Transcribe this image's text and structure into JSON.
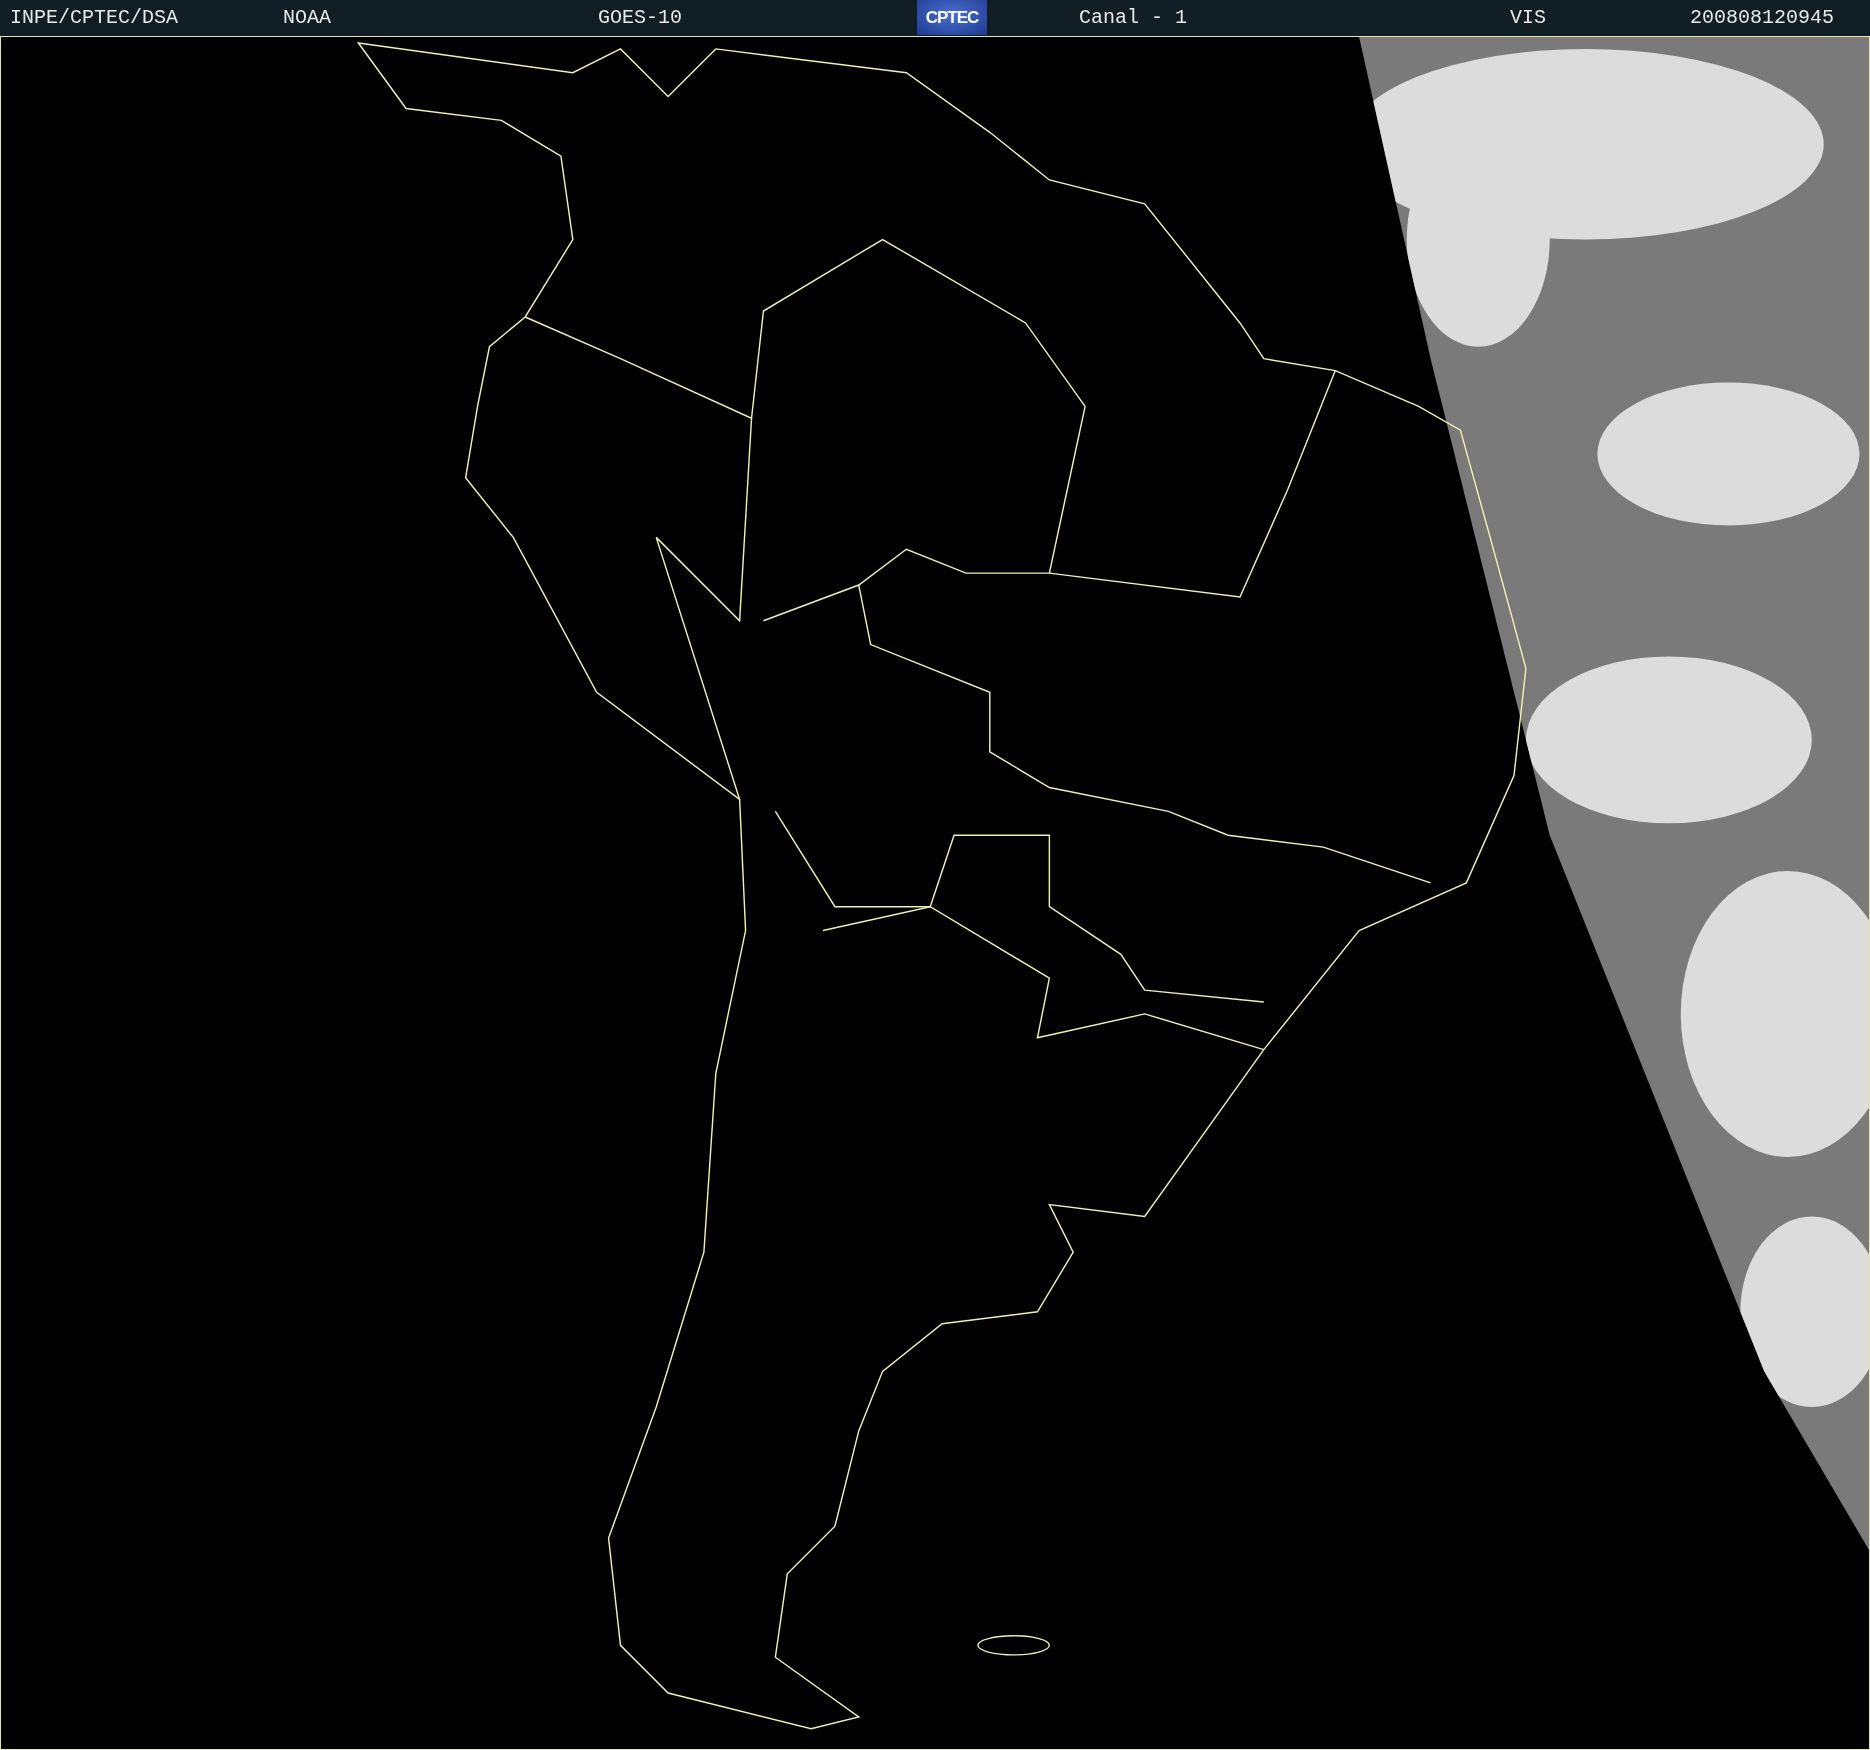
{
  "header": {
    "items": [
      {
        "kind": "text",
        "text": "INPE/CPTEC/DSA"
      },
      {
        "kind": "text",
        "text": "NOAA"
      },
      {
        "kind": "text",
        "text": "GOES-10"
      },
      {
        "kind": "logo",
        "text": "CPTEC"
      },
      {
        "kind": "text",
        "text": "Canal - 1"
      },
      {
        "kind": "text",
        "text": "VIS"
      },
      {
        "kind": "text",
        "text": "200808120945"
      }
    ]
  }
}
